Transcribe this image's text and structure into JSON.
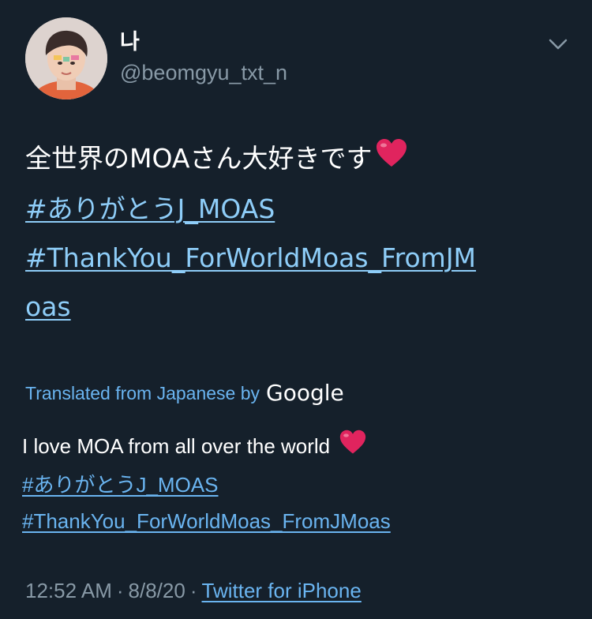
{
  "user": {
    "display_name": "나",
    "handle": "@beomgyu_txt_n"
  },
  "tweet": {
    "text": "全世界のMOAさん大好きです",
    "hashtag_1": "#ありがとうJ_MOAS",
    "hashtag_2_line1": "#ThankYou_ForWorldMoas_FromJM",
    "hashtag_2_line2": "oas"
  },
  "translation": {
    "label": "Translated from Japanese by",
    "provider": "Google",
    "text": "I love MOA from all over the world",
    "hashtag_1": "#ありがとうJ_MOAS",
    "hashtag_2": "#ThankYou_ForWorldMoas_FromJMoas"
  },
  "footer": {
    "time": "12:52 AM",
    "date": "8/8/20",
    "separator": "·",
    "source": "Twitter for iPhone"
  },
  "icons": {
    "menu": "chevron-down-icon",
    "emoji": "red-heart-icon"
  },
  "colors": {
    "background": "#15202b",
    "link": "#1da1f2",
    "secondary_text": "#8899a6",
    "heart": "#e0245e"
  }
}
